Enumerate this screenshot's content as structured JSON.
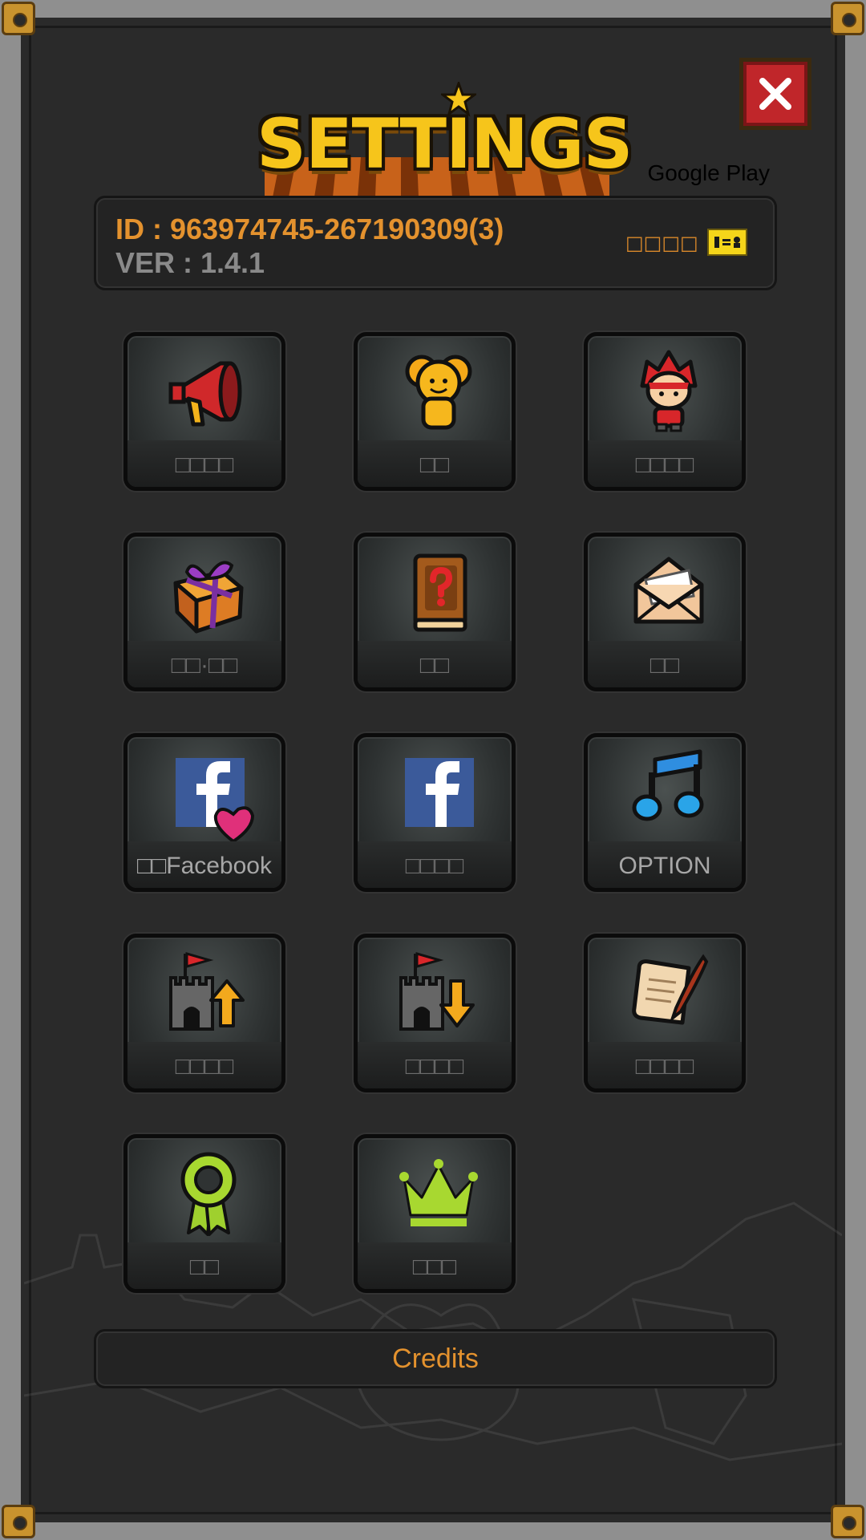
{
  "header": {
    "title": "SETTINGS",
    "platform_label": "Google Play",
    "close_icon": "close-icon"
  },
  "account": {
    "id_text": "ID : 963974745-267190309(3)",
    "version_text": "VER : 1.4.1",
    "link_label": "□□□□",
    "copy_icon": "copy-icon"
  },
  "tiles": [
    {
      "label": "□□□□",
      "icon": "megaphone-icon"
    },
    {
      "label": "□□",
      "icon": "buddy-icon"
    },
    {
      "label": "□□□□",
      "icon": "hero-icon"
    },
    {
      "label": "□□·□□",
      "icon": "gift-box-icon"
    },
    {
      "label": "□□",
      "icon": "help-book-icon"
    },
    {
      "label": "□□",
      "icon": "mail-icon"
    },
    {
      "label": "□□Facebook",
      "icon": "facebook-like-icon"
    },
    {
      "label": "□□□□",
      "icon": "facebook-icon"
    },
    {
      "label": "OPTION",
      "icon": "music-note-icon"
    },
    {
      "label": "□□□□",
      "icon": "castle-upload-icon"
    },
    {
      "label": "□□□□",
      "icon": "castle-download-icon"
    },
    {
      "label": "□□□□",
      "icon": "scroll-quill-icon"
    },
    {
      "label": "□□",
      "icon": "achievement-ribbon-icon"
    },
    {
      "label": "□□□",
      "icon": "crown-icon"
    }
  ],
  "footer": {
    "credits_label": "Credits"
  },
  "colors": {
    "accent": "#e4922e",
    "title": "#f6c51b",
    "close": "#c0262a",
    "panel": "#232323"
  }
}
